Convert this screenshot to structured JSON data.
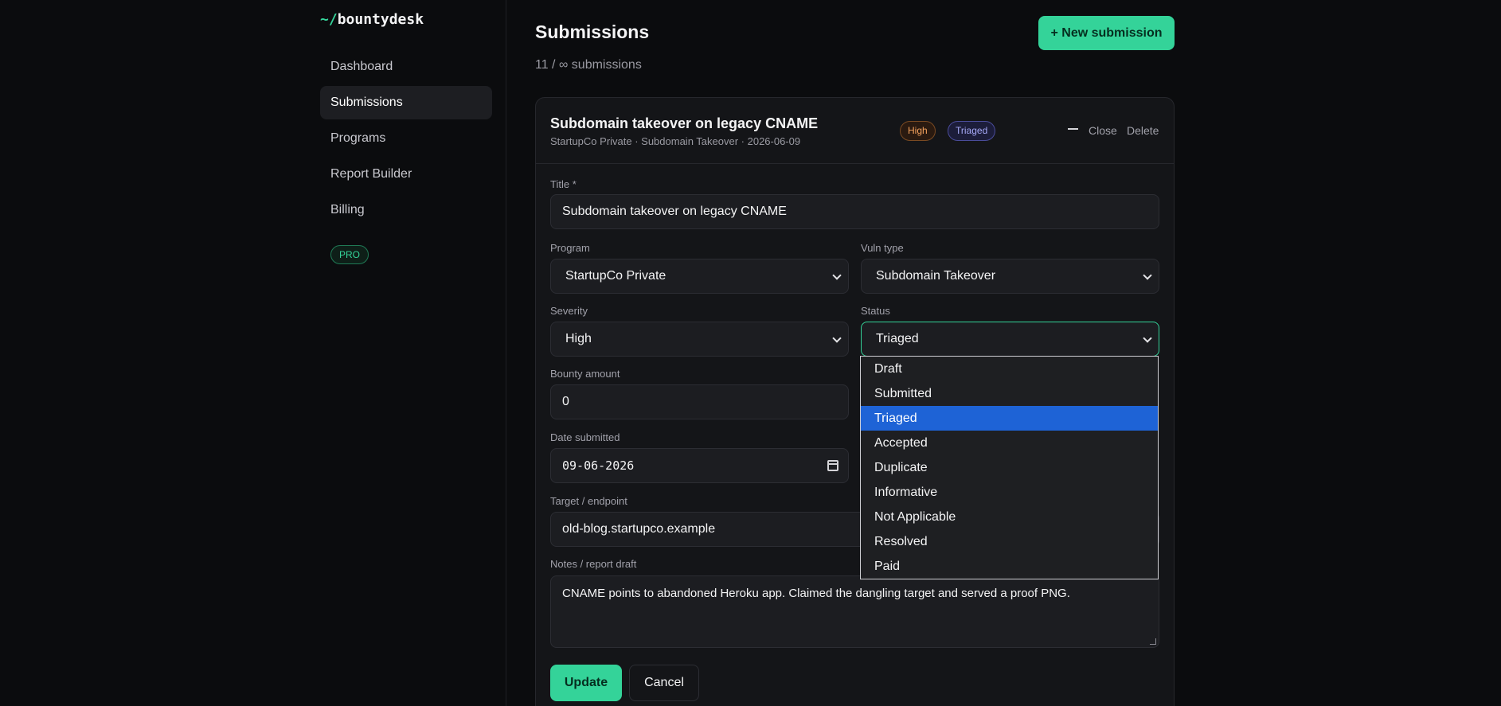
{
  "sidebar": {
    "logo_prefix": "~/",
    "logo_name": "bountydesk",
    "items": [
      {
        "label": "Dashboard"
      },
      {
        "label": "Submissions"
      },
      {
        "label": "Programs"
      },
      {
        "label": "Report Builder"
      },
      {
        "label": "Billing"
      }
    ],
    "active_index": 1,
    "plan_badge": "PRO"
  },
  "header": {
    "title": "Submissions",
    "subtitle": "11 / ∞ submissions",
    "new_button": "+ New submission"
  },
  "card": {
    "title": "Subdomain takeover on legacy CNAME",
    "meta": "StartupCo Private · Subdomain Takeover · 2026-06-09",
    "badges": {
      "severity": "High",
      "status": "Triaged"
    },
    "close_label": "Close",
    "delete_label": "Delete"
  },
  "form": {
    "title_label": "Title *",
    "title_value": "Subdomain takeover on legacy CNAME",
    "program_label": "Program",
    "program_value": "StartupCo Private",
    "vuln_label": "Vuln type",
    "vuln_value": "Subdomain Takeover",
    "severity_label": "Severity",
    "severity_value": "High",
    "status_label": "Status",
    "status_value": "Triaged",
    "bounty_label": "Bounty amount",
    "bounty_value": "0",
    "date_label": "Date submitted",
    "date_value": "09-06-2026",
    "target_label": "Target / endpoint",
    "target_value": "old-blog.startupco.example",
    "notes_label": "Notes / report draft",
    "notes_value": "CNAME points to abandoned Heroku app. Claimed the dangling target and served a proof PNG.",
    "update_label": "Update",
    "cancel_label": "Cancel"
  },
  "status_dropdown": {
    "options": [
      "Draft",
      "Submitted",
      "Triaged",
      "Accepted",
      "Duplicate",
      "Informative",
      "Not Applicable",
      "Resolved",
      "Paid"
    ],
    "selected": "Triaged"
  },
  "colors": {
    "accent": "#34d399",
    "background": "#0b0c0e",
    "card": "#141518",
    "selected_option": "#1e63d6"
  }
}
